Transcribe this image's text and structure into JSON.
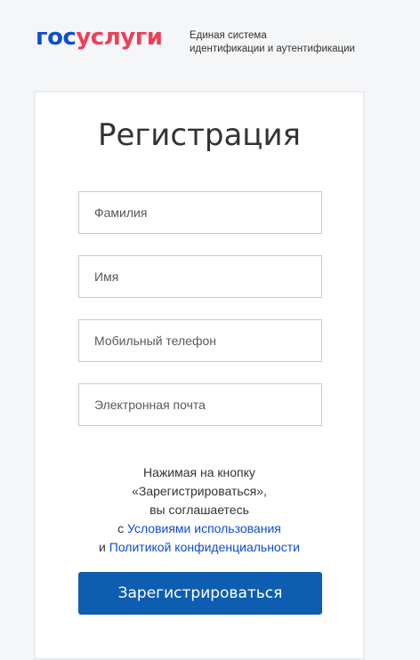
{
  "header": {
    "logo_part1": "гос",
    "logo_part2": "услуги",
    "tagline_line1": "Единая система",
    "tagline_line2": "идентификации и аутентификации"
  },
  "form": {
    "title": "Регистрация",
    "fields": [
      {
        "placeholder": "Фамилия",
        "value": ""
      },
      {
        "placeholder": "Имя",
        "value": ""
      },
      {
        "placeholder": "Мобильный телефон",
        "value": ""
      },
      {
        "placeholder": "Электронная почта",
        "value": ""
      }
    ],
    "agreement": {
      "line1": "Нажимая на кнопку",
      "line2": "«Зарегистрироваться»,",
      "line3": "вы соглашаетесь",
      "line4_prefix": "с",
      "terms_link": "Условиями использования",
      "line5_prefix": "и",
      "privacy_link": "Политикой конфиденциальности"
    },
    "submit_label": "Зарегистрироваться"
  },
  "colors": {
    "brand_blue": "#0d4cd3",
    "brand_red": "#ee3f58",
    "button": "#0d5eb0",
    "background": "#f5f6f7"
  }
}
